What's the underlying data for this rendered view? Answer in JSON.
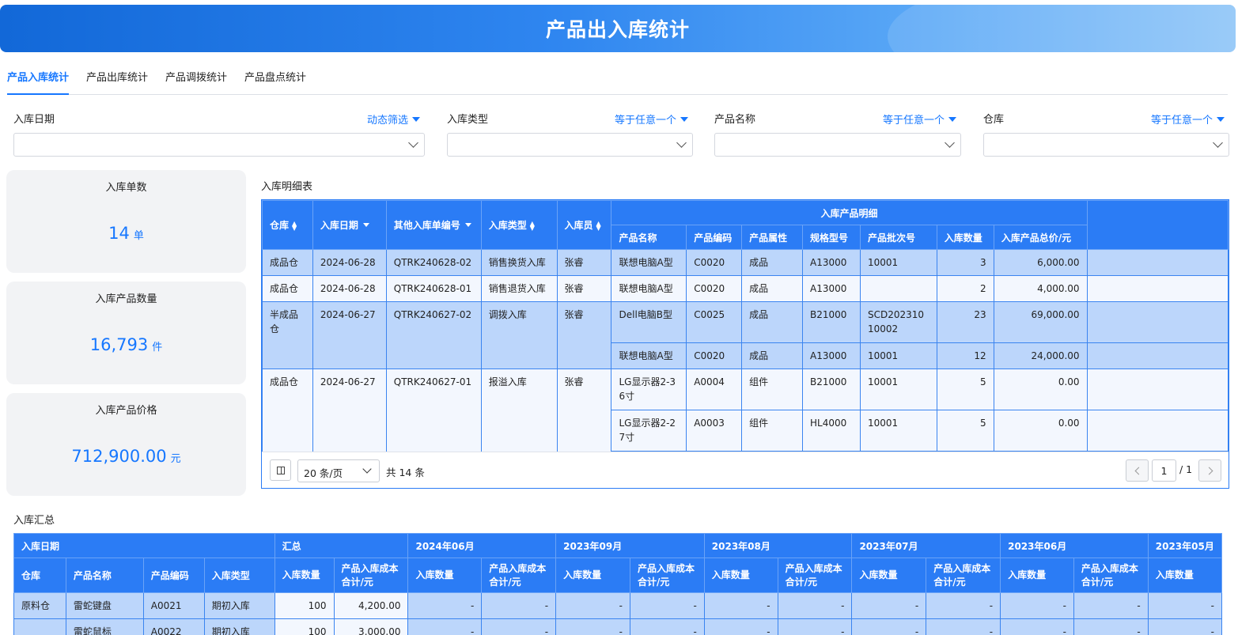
{
  "title": "产品出入库统计",
  "tabs": [
    "产品入库统计",
    "产品出库统计",
    "产品调拨统计",
    "产品盘点统计"
  ],
  "filters": [
    {
      "label": "入库日期",
      "mode": "动态筛选"
    },
    {
      "label": "入库类型",
      "mode": "等于任意一个"
    },
    {
      "label": "产品名称",
      "mode": "等于任意一个"
    },
    {
      "label": "仓库",
      "mode": "等于任意一个"
    }
  ],
  "cards": [
    {
      "title": "入库单数",
      "value": "14",
      "unit": "单"
    },
    {
      "title": "入库产品数量",
      "value": "16,793",
      "unit": "件"
    },
    {
      "title": "入库产品价格",
      "value": "712,900.00",
      "unit": "元"
    }
  ],
  "detail": {
    "title": "入库明细表",
    "group_header": "入库产品明细",
    "left_headers": [
      "仓库",
      "入库日期",
      "其他入库单编号",
      "入库类型",
      "入库员"
    ],
    "right_headers": [
      "产品名称",
      "产品编码",
      "产品属性",
      "规格型号",
      "产品批次号",
      "入库数量",
      "入库产品总价/元"
    ],
    "orders": [
      {
        "warehouse": "成品仓",
        "date": "2024-06-28",
        "no": "QTRK240628-02",
        "type": "销售换货入库",
        "clerk": "张睿",
        "items": [
          {
            "name": "联想电脑A型",
            "code": "C0020",
            "attr": "成品",
            "spec": "A13000",
            "batch": "10001",
            "qty": "3",
            "total": "6,000.00"
          }
        ]
      },
      {
        "warehouse": "成品仓",
        "date": "2024-06-28",
        "no": "QTRK240628-01",
        "type": "销售退货入库",
        "clerk": "张睿",
        "items": [
          {
            "name": "联想电脑A型",
            "code": "C0020",
            "attr": "成品",
            "spec": "A13000",
            "batch": "",
            "qty": "2",
            "total": "4,000.00"
          }
        ]
      },
      {
        "warehouse": "半成品仓",
        "date": "2024-06-27",
        "no": "QTRK240627-02",
        "type": "调拨入库",
        "clerk": "张睿",
        "items": [
          {
            "name": "Dell电脑B型",
            "code": "C0025",
            "attr": "成品",
            "spec": "B21000",
            "batch": "SCD20231010002",
            "qty": "23",
            "total": "69,000.00"
          },
          {
            "name": "联想电脑A型",
            "code": "C0020",
            "attr": "成品",
            "spec": "A13000",
            "batch": "10001",
            "qty": "12",
            "total": "24,000.00"
          }
        ]
      },
      {
        "warehouse": "成品仓",
        "date": "2024-06-27",
        "no": "QTRK240627-01",
        "type": "报溢入库",
        "clerk": "张睿",
        "items": [
          {
            "name": "LG显示器2-36寸",
            "code": "A0004",
            "attr": "组件",
            "spec": "B21000",
            "batch": "10001",
            "qty": "5",
            "total": "0.00"
          },
          {
            "name": "LG显示器2-27寸",
            "code": "A0003",
            "attr": "组件",
            "spec": "HL4000",
            "batch": "10001",
            "qty": "5",
            "total": "0.00"
          },
          {
            "name": "",
            "code": "",
            "attr": "",
            "spec": "",
            "batch": "",
            "qty": "",
            "total": ""
          }
        ]
      }
    ],
    "pager": {
      "page_size": "20 条/页",
      "total_text": "共 14 条",
      "current": "1",
      "total_pages": "/ 1"
    }
  },
  "summary": {
    "title": "入库汇总",
    "date_header": "入库日期",
    "total_header": "汇总",
    "months": [
      "2024年06月",
      "2023年09月",
      "2023年08月",
      "2023年07月",
      "2023年06月",
      "2023年05月"
    ],
    "row_headers": [
      "仓库",
      "产品名称",
      "产品编码",
      "入库类型"
    ],
    "metric_headers": [
      "入库数量",
      "产品入库成本合计/元"
    ],
    "rows": [
      {
        "warehouse": "原料仓",
        "name": "雷蛇键盘",
        "code": "A0021",
        "type": "期初入库",
        "qty": "100",
        "cost": "4,200.00"
      },
      {
        "warehouse": "",
        "name": "雷蛇鼠标",
        "code": "A0022",
        "type": "期初入库",
        "qty": "100",
        "cost": "3,000.00"
      }
    ],
    "empty_cell": "-"
  }
}
